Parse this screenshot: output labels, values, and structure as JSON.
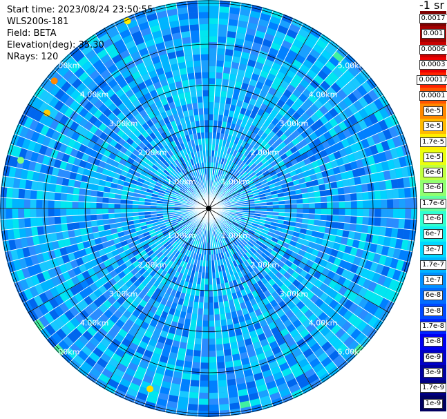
{
  "info": {
    "start_time": "Start time: 2023/08/24 23:50:55",
    "instrument": "WLS200s-181",
    "field": "Field: BETA",
    "elevation": "Elevation(deg): 35.30",
    "nrays": "NRays: 120"
  },
  "colorbar": {
    "title": "-1 sr",
    "levels": [
      {
        "label": "0.0017",
        "color": "#7f0000"
      },
      {
        "label": "0.001",
        "color": "#a30000"
      },
      {
        "label": "0.0006",
        "color": "#c80000"
      },
      {
        "label": "0.0003",
        "color": "#ee0000"
      },
      {
        "label": "0.00017",
        "color": "#ff2200"
      },
      {
        "label": "0.0001",
        "color": "#ff5500"
      },
      {
        "label": "6e-5",
        "color": "#ff8800"
      },
      {
        "label": "3e-5",
        "color": "#ffbb00"
      },
      {
        "label": "1.7e-5",
        "color": "#ffee00"
      },
      {
        "label": "1e-5",
        "color": "#eaff10"
      },
      {
        "label": "6e-6",
        "color": "#c0ff40"
      },
      {
        "label": "3e-6",
        "color": "#90ff70"
      },
      {
        "label": "1.7e-6",
        "color": "#60ffa0"
      },
      {
        "label": "1e-6",
        "color": "#30ffd0"
      },
      {
        "label": "6e-7",
        "color": "#10f0f0"
      },
      {
        "label": "3e-7",
        "color": "#00d8ff"
      },
      {
        "label": "1.7e-7",
        "color": "#00b4ff"
      },
      {
        "label": "1e-7",
        "color": "#0090ff"
      },
      {
        "label": "6e-8",
        "color": "#006cff"
      },
      {
        "label": "3e-8",
        "color": "#0048ff"
      },
      {
        "label": "1.7e-8",
        "color": "#0024ff"
      },
      {
        "label": "1e-8",
        "color": "#0000f0"
      },
      {
        "label": "6e-9",
        "color": "#0000c8"
      },
      {
        "label": "3e-9",
        "color": "#0000a0"
      },
      {
        "label": "1.7e-9",
        "color": "#000080"
      },
      {
        "label": "1e-9",
        "color": "#000060"
      }
    ]
  },
  "rings": [
    "1.00km",
    "2.00km",
    "3.00km",
    "4.00km",
    "5.00km"
  ],
  "palette": [
    "#0080ff",
    "#00b4ff",
    "#1aa0ff",
    "#00d2ff",
    "#0066ee",
    "#18c8ff",
    "#00e6f0",
    "#2a8cff"
  ]
}
